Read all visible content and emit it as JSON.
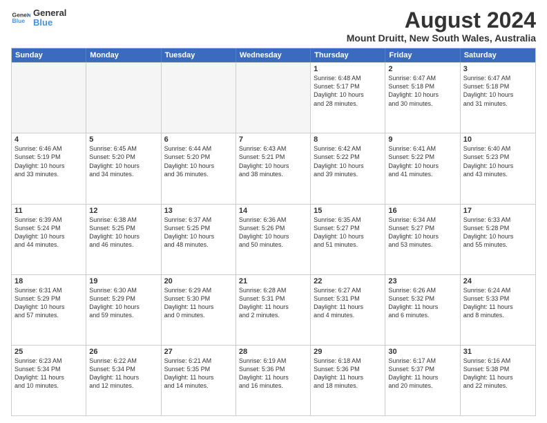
{
  "logo": {
    "line1": "General",
    "line2": "Blue"
  },
  "title": "August 2024",
  "location": "Mount Druitt, New South Wales, Australia",
  "days_of_week": [
    "Sunday",
    "Monday",
    "Tuesday",
    "Wednesday",
    "Thursday",
    "Friday",
    "Saturday"
  ],
  "rows": [
    [
      {
        "day": "",
        "info": "",
        "empty": true
      },
      {
        "day": "",
        "info": "",
        "empty": true
      },
      {
        "day": "",
        "info": "",
        "empty": true
      },
      {
        "day": "",
        "info": "",
        "empty": true
      },
      {
        "day": "1",
        "info": "Sunrise: 6:48 AM\nSunset: 5:17 PM\nDaylight: 10 hours\nand 28 minutes.",
        "empty": false
      },
      {
        "day": "2",
        "info": "Sunrise: 6:47 AM\nSunset: 5:18 PM\nDaylight: 10 hours\nand 30 minutes.",
        "empty": false
      },
      {
        "day": "3",
        "info": "Sunrise: 6:47 AM\nSunset: 5:18 PM\nDaylight: 10 hours\nand 31 minutes.",
        "empty": false
      }
    ],
    [
      {
        "day": "4",
        "info": "Sunrise: 6:46 AM\nSunset: 5:19 PM\nDaylight: 10 hours\nand 33 minutes.",
        "empty": false
      },
      {
        "day": "5",
        "info": "Sunrise: 6:45 AM\nSunset: 5:20 PM\nDaylight: 10 hours\nand 34 minutes.",
        "empty": false
      },
      {
        "day": "6",
        "info": "Sunrise: 6:44 AM\nSunset: 5:20 PM\nDaylight: 10 hours\nand 36 minutes.",
        "empty": false
      },
      {
        "day": "7",
        "info": "Sunrise: 6:43 AM\nSunset: 5:21 PM\nDaylight: 10 hours\nand 38 minutes.",
        "empty": false
      },
      {
        "day": "8",
        "info": "Sunrise: 6:42 AM\nSunset: 5:22 PM\nDaylight: 10 hours\nand 39 minutes.",
        "empty": false
      },
      {
        "day": "9",
        "info": "Sunrise: 6:41 AM\nSunset: 5:22 PM\nDaylight: 10 hours\nand 41 minutes.",
        "empty": false
      },
      {
        "day": "10",
        "info": "Sunrise: 6:40 AM\nSunset: 5:23 PM\nDaylight: 10 hours\nand 43 minutes.",
        "empty": false
      }
    ],
    [
      {
        "day": "11",
        "info": "Sunrise: 6:39 AM\nSunset: 5:24 PM\nDaylight: 10 hours\nand 44 minutes.",
        "empty": false
      },
      {
        "day": "12",
        "info": "Sunrise: 6:38 AM\nSunset: 5:25 PM\nDaylight: 10 hours\nand 46 minutes.",
        "empty": false
      },
      {
        "day": "13",
        "info": "Sunrise: 6:37 AM\nSunset: 5:25 PM\nDaylight: 10 hours\nand 48 minutes.",
        "empty": false
      },
      {
        "day": "14",
        "info": "Sunrise: 6:36 AM\nSunset: 5:26 PM\nDaylight: 10 hours\nand 50 minutes.",
        "empty": false
      },
      {
        "day": "15",
        "info": "Sunrise: 6:35 AM\nSunset: 5:27 PM\nDaylight: 10 hours\nand 51 minutes.",
        "empty": false
      },
      {
        "day": "16",
        "info": "Sunrise: 6:34 AM\nSunset: 5:27 PM\nDaylight: 10 hours\nand 53 minutes.",
        "empty": false
      },
      {
        "day": "17",
        "info": "Sunrise: 6:33 AM\nSunset: 5:28 PM\nDaylight: 10 hours\nand 55 minutes.",
        "empty": false
      }
    ],
    [
      {
        "day": "18",
        "info": "Sunrise: 6:31 AM\nSunset: 5:29 PM\nDaylight: 10 hours\nand 57 minutes.",
        "empty": false
      },
      {
        "day": "19",
        "info": "Sunrise: 6:30 AM\nSunset: 5:29 PM\nDaylight: 10 hours\nand 59 minutes.",
        "empty": false
      },
      {
        "day": "20",
        "info": "Sunrise: 6:29 AM\nSunset: 5:30 PM\nDaylight: 11 hours\nand 0 minutes.",
        "empty": false
      },
      {
        "day": "21",
        "info": "Sunrise: 6:28 AM\nSunset: 5:31 PM\nDaylight: 11 hours\nand 2 minutes.",
        "empty": false
      },
      {
        "day": "22",
        "info": "Sunrise: 6:27 AM\nSunset: 5:31 PM\nDaylight: 11 hours\nand 4 minutes.",
        "empty": false
      },
      {
        "day": "23",
        "info": "Sunrise: 6:26 AM\nSunset: 5:32 PM\nDaylight: 11 hours\nand 6 minutes.",
        "empty": false
      },
      {
        "day": "24",
        "info": "Sunrise: 6:24 AM\nSunset: 5:33 PM\nDaylight: 11 hours\nand 8 minutes.",
        "empty": false
      }
    ],
    [
      {
        "day": "25",
        "info": "Sunrise: 6:23 AM\nSunset: 5:34 PM\nDaylight: 11 hours\nand 10 minutes.",
        "empty": false
      },
      {
        "day": "26",
        "info": "Sunrise: 6:22 AM\nSunset: 5:34 PM\nDaylight: 11 hours\nand 12 minutes.",
        "empty": false
      },
      {
        "day": "27",
        "info": "Sunrise: 6:21 AM\nSunset: 5:35 PM\nDaylight: 11 hours\nand 14 minutes.",
        "empty": false
      },
      {
        "day": "28",
        "info": "Sunrise: 6:19 AM\nSunset: 5:36 PM\nDaylight: 11 hours\nand 16 minutes.",
        "empty": false
      },
      {
        "day": "29",
        "info": "Sunrise: 6:18 AM\nSunset: 5:36 PM\nDaylight: 11 hours\nand 18 minutes.",
        "empty": false
      },
      {
        "day": "30",
        "info": "Sunrise: 6:17 AM\nSunset: 5:37 PM\nDaylight: 11 hours\nand 20 minutes.",
        "empty": false
      },
      {
        "day": "31",
        "info": "Sunrise: 6:16 AM\nSunset: 5:38 PM\nDaylight: 11 hours\nand 22 minutes.",
        "empty": false
      }
    ]
  ]
}
